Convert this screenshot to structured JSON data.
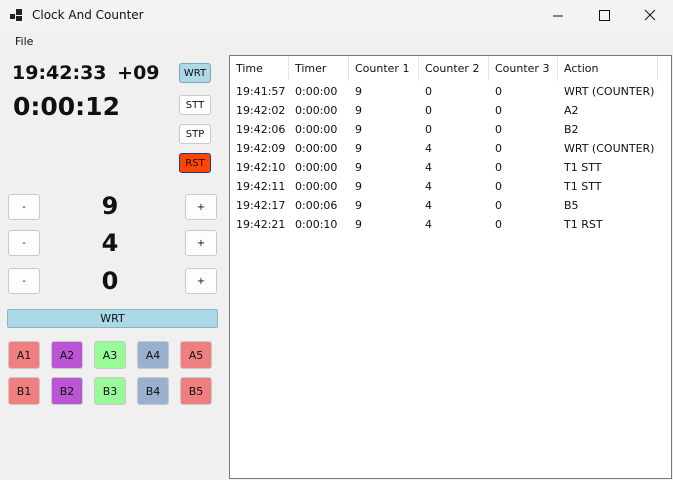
{
  "window": {
    "title": "Clock And Counter"
  },
  "menu": {
    "file": "File"
  },
  "clock": {
    "time": "19:42:33",
    "offset": "+09",
    "timer": "0:00:12"
  },
  "side_buttons": {
    "wrt": "WRT",
    "stt": "STT",
    "stp": "STP",
    "rst": "RST"
  },
  "counters": [
    {
      "value": "9",
      "minus": "-",
      "plus": "+"
    },
    {
      "value": "4",
      "minus": "-",
      "plus": "+"
    },
    {
      "value": "0",
      "minus": "-",
      "plus": "+"
    }
  ],
  "wrt_bar": "WRT",
  "group_a": [
    "A1",
    "A2",
    "A3",
    "A4",
    "A5"
  ],
  "group_b": [
    "B1",
    "B2",
    "B3",
    "B4",
    "B5"
  ],
  "colors": {
    "wrt": "#add8e6",
    "rst": "#ff4500",
    "col1": "#f08080",
    "col2": "#ba55d3",
    "col3": "#98fb98",
    "col4": "#9ab0cf",
    "col5": "#f08080"
  },
  "log": {
    "columns": [
      "Time",
      "Timer",
      "Counter 1",
      "Counter 2",
      "Counter 3",
      "Action"
    ],
    "rows": [
      [
        "19:41:57",
        "0:00:00",
        "9",
        "0",
        "0",
        "WRT (COUNTER)"
      ],
      [
        "19:42:02",
        "0:00:00",
        "9",
        "0",
        "0",
        "A2"
      ],
      [
        "19:42:06",
        "0:00:00",
        "9",
        "0",
        "0",
        "B2"
      ],
      [
        "19:42:09",
        "0:00:00",
        "9",
        "4",
        "0",
        "WRT (COUNTER)"
      ],
      [
        "19:42:10",
        "0:00:00",
        "9",
        "4",
        "0",
        "T1 STT"
      ],
      [
        "19:42:11",
        "0:00:00",
        "9",
        "4",
        "0",
        "T1 STT"
      ],
      [
        "19:42:17",
        "0:00:06",
        "9",
        "4",
        "0",
        "B5"
      ],
      [
        "19:42:21",
        "0:00:10",
        "9",
        "4",
        "0",
        "T1 RST"
      ]
    ]
  }
}
